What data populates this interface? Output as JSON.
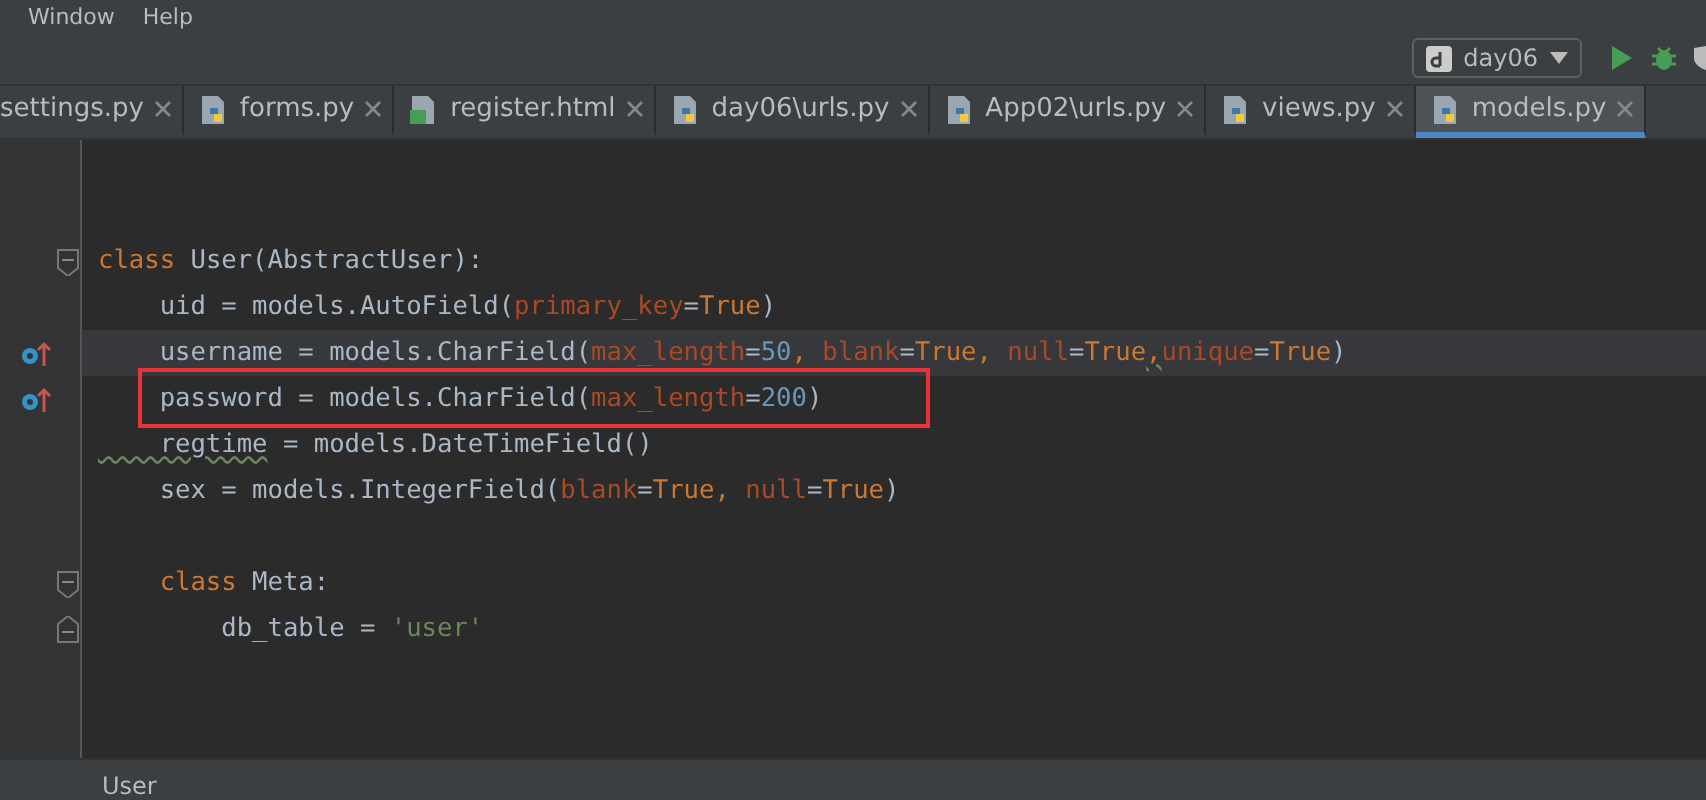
{
  "menu": [
    "Window",
    "Help"
  ],
  "toolbar": {
    "run_config": "day06"
  },
  "tabs": [
    {
      "label": "settings.py",
      "selected": false
    },
    {
      "label": "forms.py",
      "kind": "python",
      "selected": false
    },
    {
      "label": "register.html",
      "kind": "html",
      "selected": false
    },
    {
      "label": "day06\\urls.py",
      "kind": "python",
      "selected": false
    },
    {
      "label": "App02\\urls.py",
      "kind": "python",
      "selected": false
    },
    {
      "label": "views.py",
      "kind": "python",
      "selected": false
    },
    {
      "label": "models.py",
      "kind": "python",
      "selected": true
    }
  ],
  "code_lines": [
    {
      "kind": "fold",
      "current": false,
      "boxed": false,
      "tokens": [
        {
          "t": "class",
          "kind": "kw"
        },
        {
          "t": " User(AbstractUser):",
          "kind": "plain"
        }
      ]
    },
    {
      "kind": "plain",
      "current": false,
      "boxed": false,
      "tokens": [
        {
          "t": "    uid = models.AutoField(",
          "kind": "plain"
        },
        {
          "t": "primary_key",
          "kind": "param"
        },
        {
          "t": "=",
          "kind": "plain"
        },
        {
          "t": "True",
          "kind": "kw"
        },
        {
          "t": ")",
          "kind": "plain"
        }
      ]
    },
    {
      "kind": "override",
      "current": true,
      "boxed": false,
      "tokens": [
        {
          "t": "    username = models.CharField(",
          "kind": "plain"
        },
        {
          "t": "max_length",
          "kind": "param"
        },
        {
          "t": "=",
          "kind": "plain"
        },
        {
          "t": "50",
          "kind": "num"
        },
        {
          "t": ", ",
          "kind": "kw"
        },
        {
          "t": "blank",
          "kind": "param"
        },
        {
          "t": "=",
          "kind": "plain"
        },
        {
          "t": "True",
          "kind": "kw"
        },
        {
          "t": ", ",
          "kind": "kw"
        },
        {
          "t": "null",
          "kind": "param"
        },
        {
          "t": "=",
          "kind": "plain"
        },
        {
          "t": "True",
          "kind": "kw"
        },
        {
          "t": ",",
          "kind": "kw",
          "warn": true
        },
        {
          "t": "unique",
          "kind": "param"
        },
        {
          "t": "=",
          "kind": "plain"
        },
        {
          "t": "True",
          "kind": "kw"
        },
        {
          "t": ")",
          "kind": "plain"
        }
      ]
    },
    {
      "kind": "override",
      "current": false,
      "boxed": true,
      "tokens": [
        {
          "t": "    password = models.CharField(",
          "kind": "plain"
        },
        {
          "t": "max_length",
          "kind": "param"
        },
        {
          "t": "=",
          "kind": "plain"
        },
        {
          "t": "200",
          "kind": "num"
        },
        {
          "t": ")",
          "kind": "plain"
        }
      ]
    },
    {
      "kind": "plain",
      "current": false,
      "boxed": false,
      "tokens": [
        {
          "t": "    regtime",
          "kind": "plain",
          "warn": true
        },
        {
          "t": " = models.DateTimeField()",
          "kind": "plain"
        }
      ]
    },
    {
      "kind": "plain",
      "current": false,
      "boxed": false,
      "tokens": [
        {
          "t": "    sex = models.IntegerField(",
          "kind": "plain"
        },
        {
          "t": "blank",
          "kind": "param"
        },
        {
          "t": "=",
          "kind": "plain"
        },
        {
          "t": "True",
          "kind": "kw"
        },
        {
          "t": ", ",
          "kind": "kw"
        },
        {
          "t": "null",
          "kind": "param"
        },
        {
          "t": "=",
          "kind": "plain"
        },
        {
          "t": "True",
          "kind": "kw"
        },
        {
          "t": ")",
          "kind": "plain"
        }
      ]
    },
    {
      "kind": "blank",
      "current": false,
      "boxed": false
    },
    {
      "kind": "fold",
      "current": false,
      "boxed": false,
      "tokens": [
        {
          "t": "    class",
          "kind": "kw"
        },
        {
          "t": " Meta:",
          "kind": "plain"
        }
      ]
    },
    {
      "kind": "fold-end",
      "current": false,
      "boxed": false,
      "tokens": [
        {
          "t": "        db_table = ",
          "kind": "plain"
        },
        {
          "t": "'user'",
          "kind": "str"
        }
      ]
    }
  ],
  "status_bar": {
    "breadcrumb": "User"
  }
}
